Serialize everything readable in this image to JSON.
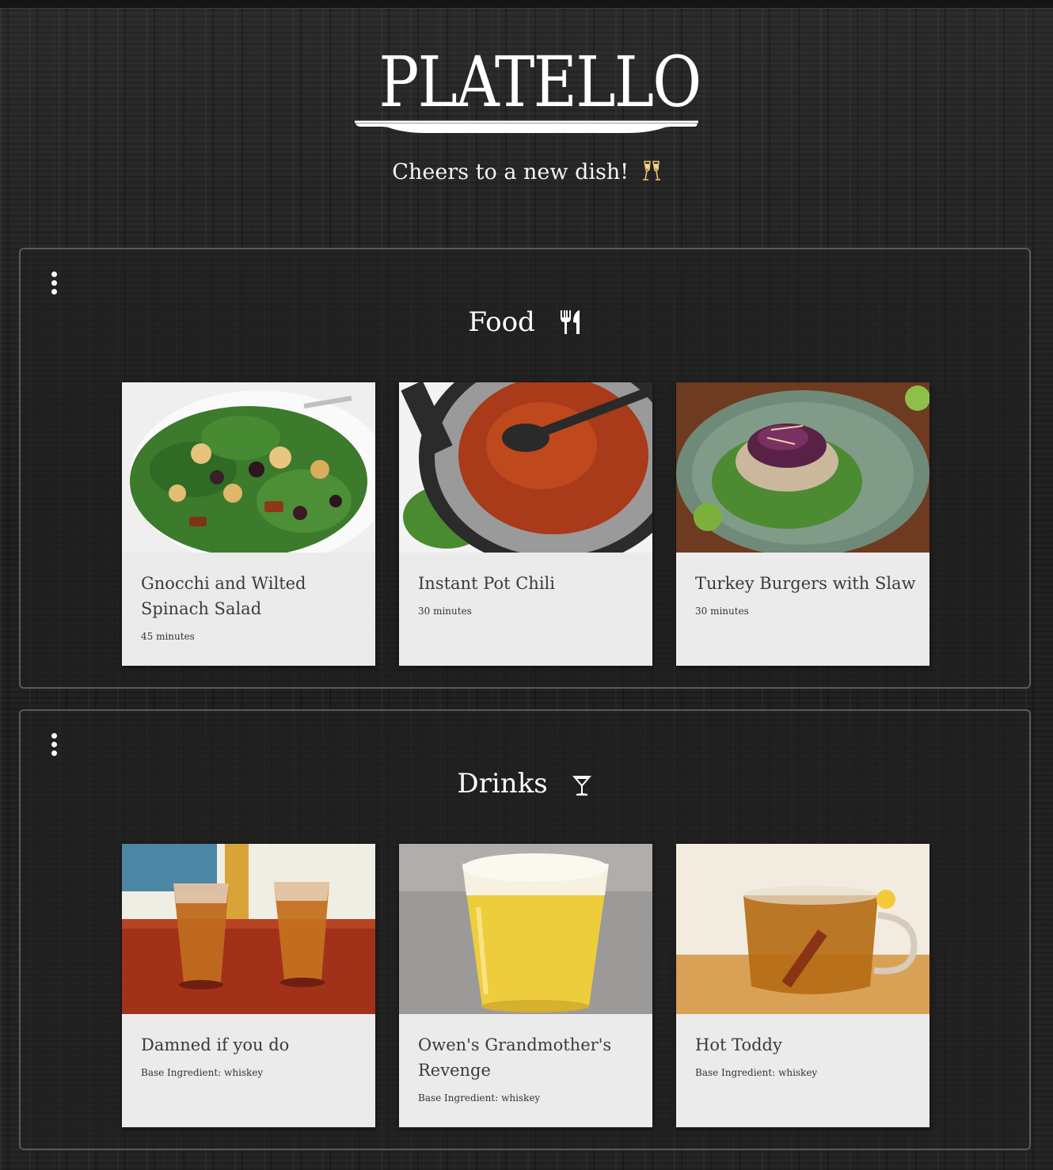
{
  "header": {
    "logo_text": "PLATELLO",
    "tagline": "Cheers to a new dish!",
    "tagline_icon": "champagne-glasses-icon"
  },
  "sections": [
    {
      "title": "Food",
      "icon": "fork-knife-icon",
      "menu_icon": "kebab-menu-icon",
      "cards": [
        {
          "title": "Gnocchi and Wilted Spinach Salad",
          "meta": "45 minutes",
          "photo": "spinach-salad-photo"
        },
        {
          "title": "Instant Pot Chili",
          "meta": "30 minutes",
          "photo": "chili-pot-photo"
        },
        {
          "title": "Turkey Burgers with Slaw",
          "meta": "30 minutes",
          "photo": "turkey-burger-photo"
        }
      ]
    },
    {
      "title": "Drinks",
      "icon": "cocktail-glass-icon",
      "menu_icon": "kebab-menu-icon",
      "cards": [
        {
          "title": "Damned if you do",
          "meta": "Base Ingredient: whiskey",
          "photo": "whiskey-shots-photo"
        },
        {
          "title": "Owen's Grandmother's Revenge",
          "meta": "Base Ingredient: whiskey",
          "photo": "frothy-drink-photo"
        },
        {
          "title": "Hot Toddy",
          "meta": "Base Ingredient: whiskey",
          "photo": "hot-toddy-photo"
        }
      ]
    }
  ],
  "colors": {
    "background": "#1c1c1c",
    "card_background": "#ebebec",
    "section_border": "#5a5a5a",
    "text_light": "#ffffff",
    "card_text": "#3b3b3b"
  }
}
